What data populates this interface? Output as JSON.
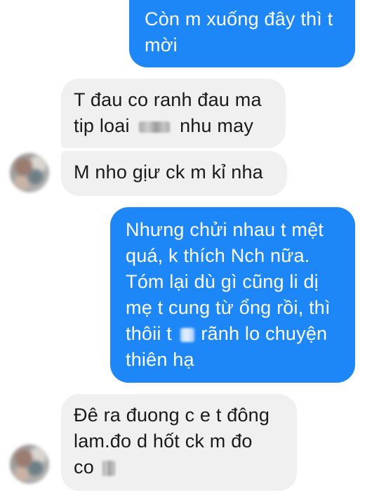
{
  "conversation": {
    "messages": [
      {
        "sender": "me",
        "lines": [
          "Còn m xuống đây thì t",
          "mời"
        ]
      },
      {
        "sender": "other",
        "line1": "T đau co ranh đau ma",
        "line2_before": "tip loai",
        "line2_after": "nhu may"
      },
      {
        "sender": "other",
        "text": "M nho gịư ck m kỉ nha"
      },
      {
        "sender": "me",
        "lines": [
          "Nhưng chửi nhau t mệt",
          "quá, k thích Nch nữa.",
          "Tóm lại dù gì cũng li dị",
          "mẹ t cung từ ổng rồi, thì"
        ],
        "line5_before": "thôii t",
        "line5_after": "rãnh lo chuyện",
        "line6": "thiên hạ"
      },
      {
        "sender": "other",
        "lines": [
          "Đê ra đuong c e t đông",
          "lam.đo d hốt ck m đo"
        ],
        "line3_before": "co"
      }
    ]
  },
  "colors": {
    "sent_bubble": "#1e87f7",
    "received_bubble": "#f1f0f0",
    "sent_text": "#ffffff",
    "received_text": "#1a1a1a"
  }
}
